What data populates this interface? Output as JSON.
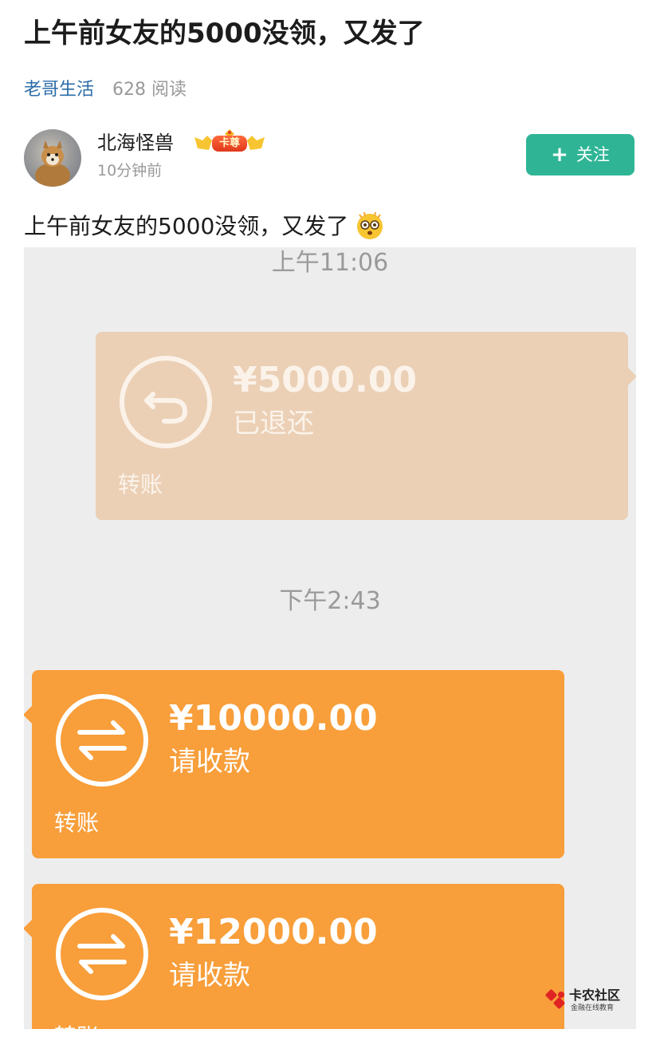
{
  "article": {
    "title": "上午前女友的5000没领，又发了",
    "channel": "老哥生活",
    "reads": "628 阅读"
  },
  "author": {
    "name": "北海怪兽",
    "badge": "卡尊",
    "time": "10分钟前",
    "follow_label": "关注"
  },
  "post": {
    "text": "上午前女友的5000没领，又发了"
  },
  "screenshot": {
    "time_labels": [
      "上午11:06",
      "下午2:43"
    ],
    "cards": [
      {
        "amount": "¥5000.00",
        "status": "已退还",
        "kind": "转账",
        "state": "returned",
        "color": "#ebd0b6"
      },
      {
        "amount": "¥10000.00",
        "status": "请收款",
        "kind": "转账",
        "state": "pending",
        "color": "#f89e3a"
      },
      {
        "amount": "¥12000.00",
        "status": "请收款",
        "kind": "转账",
        "state": "pending",
        "color": "#f89e3a"
      }
    ]
  },
  "watermark": {
    "name": "卡农社区",
    "subtitle": "金融在线教育"
  },
  "colors": {
    "accent": "#2fb595",
    "channel": "#2b6ca8",
    "returned_card": "#ebd0b6",
    "pending_card": "#f89e3a"
  }
}
